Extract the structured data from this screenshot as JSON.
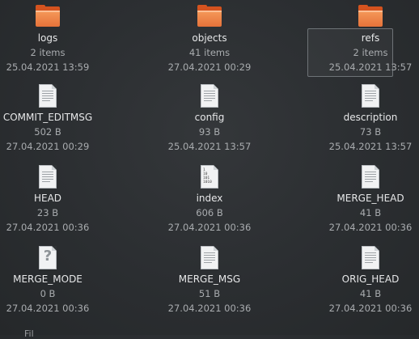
{
  "items": [
    {
      "name": "logs",
      "meta1": "2 items",
      "meta2": "25.04.2021 13:59",
      "icon": "folder-icon"
    },
    {
      "name": "objects",
      "meta1": "41 items",
      "meta2": "27.04.2021 00:29",
      "icon": "folder-icon"
    },
    {
      "name": "refs",
      "meta1": "2 items",
      "meta2": "25.04.2021 13:57",
      "icon": "folder-icon",
      "selected": true
    },
    {
      "name": "COMMIT_EDITMSG",
      "meta1": "502 B",
      "meta2": "27.04.2021 00:29",
      "icon": "text-file-icon"
    },
    {
      "name": "config",
      "meta1": "93 B",
      "meta2": "25.04.2021 13:57",
      "icon": "text-file-icon"
    },
    {
      "name": "description",
      "meta1": "73 B",
      "meta2": "25.04.2021 13:57",
      "icon": "text-file-icon"
    },
    {
      "name": "HEAD",
      "meta1": "23 B",
      "meta2": "27.04.2021 00:36",
      "icon": "text-file-icon"
    },
    {
      "name": "index",
      "meta1": "606 B",
      "meta2": "27.04.2021 00:36",
      "icon": "binary-file-icon"
    },
    {
      "name": "MERGE_HEAD",
      "meta1": "41 B",
      "meta2": "27.04.2021 00:36",
      "icon": "text-file-icon"
    },
    {
      "name": "MERGE_MODE",
      "meta1": "0 B",
      "meta2": "27.04.2021 00:36",
      "icon": "unknown-file-icon"
    },
    {
      "name": "MERGE_MSG",
      "meta1": "51 B",
      "meta2": "27.04.2021 00:36",
      "icon": "text-file-icon"
    },
    {
      "name": "ORIG_HEAD",
      "meta1": "41 B",
      "meta2": "27.04.2021 00:36",
      "icon": "text-file-icon"
    }
  ],
  "binary_glyph": "1\n10\n101\n1010",
  "status_text": "Fil"
}
